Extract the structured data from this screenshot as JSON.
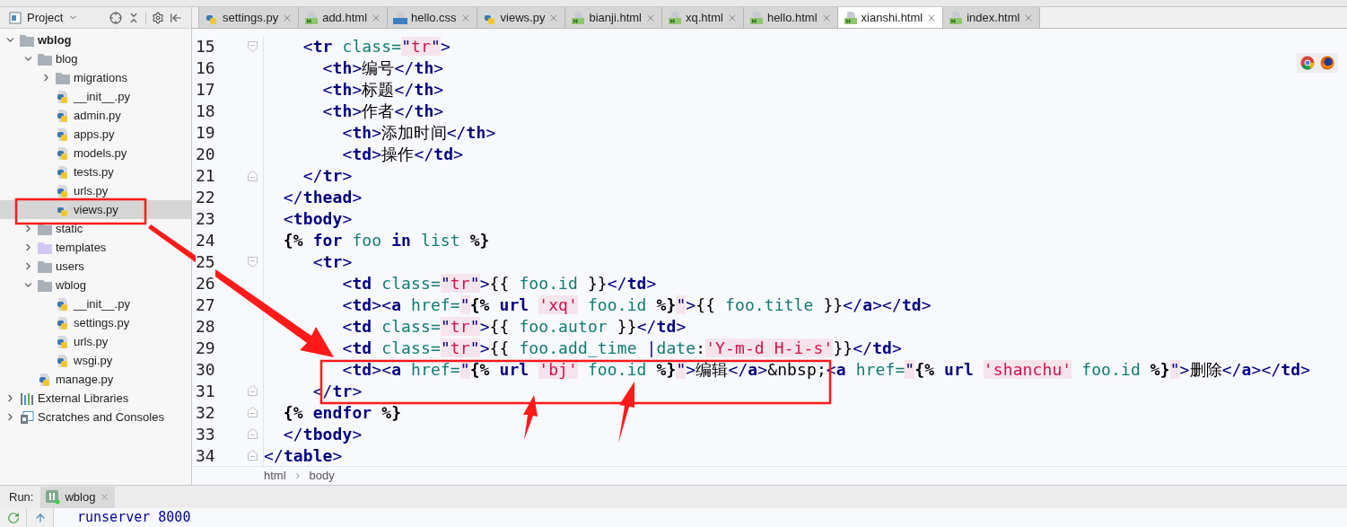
{
  "project_panel": {
    "title": "Project"
  },
  "tree": [
    {
      "label": "wblog",
      "kind": "project",
      "expanded": true,
      "selected": false,
      "children": [
        {
          "label": "blog",
          "kind": "folder",
          "expanded": true,
          "selected": false,
          "children": [
            {
              "label": "migrations",
              "kind": "folder",
              "expanded": false,
              "selected": false
            },
            {
              "label": "__init__.py",
              "kind": "py",
              "selected": false
            },
            {
              "label": "admin.py",
              "kind": "py",
              "selected": false
            },
            {
              "label": "apps.py",
              "kind": "py",
              "selected": false
            },
            {
              "label": "models.py",
              "kind": "py",
              "selected": false
            },
            {
              "label": "tests.py",
              "kind": "py",
              "selected": false
            },
            {
              "label": "urls.py",
              "kind": "py",
              "selected": false
            },
            {
              "label": "views.py",
              "kind": "py",
              "selected": true
            }
          ]
        },
        {
          "label": "static",
          "kind": "folder",
          "expanded": false,
          "selected": false
        },
        {
          "label": "templates",
          "kind": "templates",
          "expanded": false,
          "selected": false
        },
        {
          "label": "users",
          "kind": "folder",
          "expanded": false,
          "selected": false
        },
        {
          "label": "wblog",
          "kind": "folder",
          "expanded": true,
          "selected": false,
          "children": [
            {
              "label": "__init__.py",
              "kind": "py",
              "selected": false
            },
            {
              "label": "settings.py",
              "kind": "py",
              "selected": false
            },
            {
              "label": "urls.py",
              "kind": "py",
              "selected": false
            },
            {
              "label": "wsgi.py",
              "kind": "py",
              "selected": false
            }
          ]
        },
        {
          "label": "manage.py",
          "kind": "py",
          "selected": false
        }
      ]
    },
    {
      "label": "External Libraries",
      "kind": "libraries",
      "expanded": false,
      "selected": false
    },
    {
      "label": "Scratches and Consoles",
      "kind": "scratches",
      "expanded": false,
      "selected": false
    }
  ],
  "tabs": [
    {
      "label": "settings.py",
      "kind": "py",
      "selected": false
    },
    {
      "label": "add.html",
      "kind": "html",
      "selected": false
    },
    {
      "label": "hello.css",
      "kind": "css",
      "selected": false
    },
    {
      "label": "views.py",
      "kind": "py",
      "selected": false
    },
    {
      "label": "bianji.html",
      "kind": "html",
      "selected": false
    },
    {
      "label": "xq.html",
      "kind": "html",
      "selected": false
    },
    {
      "label": "hello.html",
      "kind": "html",
      "selected": false
    },
    {
      "label": "xianshi.html",
      "kind": "html",
      "selected": true
    },
    {
      "label": "index.html",
      "kind": "html",
      "selected": false
    }
  ],
  "editor": {
    "lines": [
      {
        "number": "15",
        "kind": "fold-start",
        "tokens": [
          {
            "kind": "p",
            "text": "    <"
          },
          {
            "kind": "tag",
            "text": "tr"
          },
          {
            "kind": "attr",
            "text": " class="
          },
          {
            "kind": "q",
            "text": "\""
          },
          {
            "kind": "str",
            "text": "tr"
          },
          {
            "kind": "q",
            "text": "\""
          },
          {
            "kind": "p",
            "text": ">"
          }
        ]
      },
      {
        "number": "16",
        "kind": "plain",
        "tokens": [
          {
            "kind": "p",
            "text": "      <"
          },
          {
            "kind": "tag",
            "text": "th"
          },
          {
            "kind": "p",
            "text": ">"
          },
          {
            "kind": "text",
            "text": "编号"
          },
          {
            "kind": "p",
            "text": "</"
          },
          {
            "kind": "tag",
            "text": "th"
          },
          {
            "kind": "p",
            "text": ">"
          }
        ]
      },
      {
        "number": "17",
        "kind": "plain",
        "tokens": [
          {
            "kind": "p",
            "text": "      <"
          },
          {
            "kind": "tag",
            "text": "th"
          },
          {
            "kind": "p",
            "text": ">"
          },
          {
            "kind": "text",
            "text": "标题"
          },
          {
            "kind": "p",
            "text": "</"
          },
          {
            "kind": "tag",
            "text": "th"
          },
          {
            "kind": "p",
            "text": ">"
          }
        ]
      },
      {
        "number": "18",
        "kind": "plain",
        "tokens": [
          {
            "kind": "p",
            "text": "      <"
          },
          {
            "kind": "tag",
            "text": "th"
          },
          {
            "kind": "p",
            "text": ">"
          },
          {
            "kind": "text",
            "text": "作者"
          },
          {
            "kind": "p",
            "text": "</"
          },
          {
            "kind": "tag",
            "text": "th"
          },
          {
            "kind": "p",
            "text": ">"
          }
        ]
      },
      {
        "number": "19",
        "kind": "plain",
        "tokens": [
          {
            "kind": "p",
            "text": "        <"
          },
          {
            "kind": "tag",
            "text": "th"
          },
          {
            "kind": "p",
            "text": ">"
          },
          {
            "kind": "text",
            "text": "添加时间"
          },
          {
            "kind": "p",
            "text": "</"
          },
          {
            "kind": "tag",
            "text": "th"
          },
          {
            "kind": "p",
            "text": ">"
          }
        ]
      },
      {
        "number": "20",
        "kind": "plain",
        "tokens": [
          {
            "kind": "p",
            "text": "        <"
          },
          {
            "kind": "tag",
            "text": "td"
          },
          {
            "kind": "p",
            "text": ">"
          },
          {
            "kind": "text",
            "text": "操作"
          },
          {
            "kind": "p",
            "text": "</"
          },
          {
            "kind": "tag",
            "text": "td"
          },
          {
            "kind": "p",
            "text": ">"
          }
        ]
      },
      {
        "number": "21",
        "kind": "fold-end",
        "tokens": [
          {
            "kind": "p",
            "text": "    </"
          },
          {
            "kind": "tag",
            "text": "tr"
          },
          {
            "kind": "p",
            "text": ">"
          }
        ]
      },
      {
        "number": "22",
        "kind": "plain",
        "tokens": [
          {
            "kind": "p",
            "text": "  </"
          },
          {
            "kind": "tag",
            "text": "thead"
          },
          {
            "kind": "p",
            "text": ">"
          }
        ]
      },
      {
        "number": "23",
        "kind": "plain",
        "tokens": [
          {
            "kind": "p",
            "text": "  <"
          },
          {
            "kind": "tag",
            "text": "tbody"
          },
          {
            "kind": "p",
            "text": ">"
          }
        ]
      },
      {
        "number": "24",
        "kind": "plain",
        "tokens": [
          {
            "kind": "tb",
            "text": "  {% "
          },
          {
            "kind": "kw",
            "text": "for"
          },
          {
            "kind": "var",
            "text": " foo "
          },
          {
            "kind": "kw",
            "text": "in"
          },
          {
            "kind": "var",
            "text": " list "
          },
          {
            "kind": "tb",
            "text": "%}"
          }
        ]
      },
      {
        "number": "25",
        "kind": "fold-start",
        "tokens": [
          {
            "kind": "p",
            "text": "     <"
          },
          {
            "kind": "tag",
            "text": "tr"
          },
          {
            "kind": "p",
            "text": ">"
          }
        ]
      },
      {
        "number": "26",
        "kind": "plain",
        "tokens": [
          {
            "kind": "p",
            "text": "        <"
          },
          {
            "kind": "tag",
            "text": "td"
          },
          {
            "kind": "attr",
            "text": " class="
          },
          {
            "kind": "q",
            "text": "\""
          },
          {
            "kind": "str",
            "text": "tr"
          },
          {
            "kind": "q",
            "text": "\""
          },
          {
            "kind": "p",
            "text": ">"
          },
          {
            "kind": "text",
            "text": "{{ "
          },
          {
            "kind": "var",
            "text": "foo.id"
          },
          {
            "kind": "text",
            "text": " }}"
          },
          {
            "kind": "p",
            "text": "</"
          },
          {
            "kind": "tag",
            "text": "td"
          },
          {
            "kind": "p",
            "text": ">"
          }
        ]
      },
      {
        "number": "27",
        "kind": "plain",
        "tokens": [
          {
            "kind": "p",
            "text": "        <"
          },
          {
            "kind": "tag",
            "text": "td"
          },
          {
            "kind": "p",
            "text": "><"
          },
          {
            "kind": "tag",
            "text": "a"
          },
          {
            "kind": "attr",
            "text": " href="
          },
          {
            "kind": "q",
            "text": "\""
          },
          {
            "kind": "tb",
            "text": "{% "
          },
          {
            "kind": "kw",
            "text": "url "
          },
          {
            "kind": "str",
            "text": "'xq'"
          },
          {
            "kind": "var",
            "text": " foo.id "
          },
          {
            "kind": "tb",
            "text": "%}"
          },
          {
            "kind": "q",
            "text": "\""
          },
          {
            "kind": "p",
            "text": ">"
          },
          {
            "kind": "text",
            "text": "{{ "
          },
          {
            "kind": "var",
            "text": "foo.title"
          },
          {
            "kind": "text",
            "text": " }}"
          },
          {
            "kind": "p",
            "text": "</"
          },
          {
            "kind": "tag",
            "text": "a"
          },
          {
            "kind": "p",
            "text": "></"
          },
          {
            "kind": "tag",
            "text": "td"
          },
          {
            "kind": "p",
            "text": ">"
          }
        ]
      },
      {
        "number": "28",
        "kind": "plain",
        "tokens": [
          {
            "kind": "p",
            "text": "        <"
          },
          {
            "kind": "tag",
            "text": "td"
          },
          {
            "kind": "attr",
            "text": " class="
          },
          {
            "kind": "q",
            "text": "\""
          },
          {
            "kind": "str",
            "text": "tr"
          },
          {
            "kind": "q",
            "text": "\""
          },
          {
            "kind": "p",
            "text": ">"
          },
          {
            "kind": "text",
            "text": "{{ "
          },
          {
            "kind": "var",
            "text": "foo.autor"
          },
          {
            "kind": "text",
            "text": " }}"
          },
          {
            "kind": "p",
            "text": "</"
          },
          {
            "kind": "tag",
            "text": "td"
          },
          {
            "kind": "p",
            "text": ">"
          }
        ]
      },
      {
        "number": "29",
        "kind": "plain",
        "tokens": [
          {
            "kind": "p",
            "text": "        <"
          },
          {
            "kind": "tag",
            "text": "td"
          },
          {
            "kind": "attr",
            "text": " class="
          },
          {
            "kind": "q",
            "text": "\""
          },
          {
            "kind": "str",
            "text": "tr"
          },
          {
            "kind": "q",
            "text": "\""
          },
          {
            "kind": "p",
            "text": ">"
          },
          {
            "kind": "text",
            "text": "{{ "
          },
          {
            "kind": "var",
            "text": "foo.add_time "
          },
          {
            "kind": "p",
            "text": "|"
          },
          {
            "kind": "var",
            "text": "date"
          },
          {
            "kind": "text",
            "text": ":"
          },
          {
            "kind": "str",
            "text": "'Y-m-d H-i-s'"
          },
          {
            "kind": "text",
            "text": "}}"
          },
          {
            "kind": "p",
            "text": "</"
          },
          {
            "kind": "tag",
            "text": "td"
          },
          {
            "kind": "p",
            "text": ">"
          }
        ]
      },
      {
        "number": "30",
        "kind": "plain",
        "tokens": [
          {
            "kind": "p",
            "text": "        <"
          },
          {
            "kind": "tag",
            "text": "td"
          },
          {
            "kind": "p",
            "text": "><"
          },
          {
            "kind": "tag",
            "text": "a"
          },
          {
            "kind": "attr",
            "text": " href="
          },
          {
            "kind": "q",
            "text": "\""
          },
          {
            "kind": "tb",
            "text": "{% "
          },
          {
            "kind": "kw",
            "text": "url "
          },
          {
            "kind": "str",
            "text": "'bj'"
          },
          {
            "kind": "var",
            "text": " foo.id "
          },
          {
            "kind": "tb",
            "text": "%}"
          },
          {
            "kind": "q",
            "text": "\""
          },
          {
            "kind": "p",
            "text": ">"
          },
          {
            "kind": "text",
            "text": "编辑"
          },
          {
            "kind": "p",
            "text": "</"
          },
          {
            "kind": "tag",
            "text": "a"
          },
          {
            "kind": "p",
            "text": ">"
          },
          {
            "kind": "text",
            "text": "&nbsp;"
          },
          {
            "kind": "p",
            "text": "<"
          },
          {
            "kind": "tag",
            "text": "a"
          },
          {
            "kind": "attr",
            "text": " href="
          },
          {
            "kind": "q",
            "text": "\""
          },
          {
            "kind": "tb",
            "text": "{% "
          },
          {
            "kind": "kw",
            "text": "url "
          },
          {
            "kind": "str",
            "text": "'shanchu'"
          },
          {
            "kind": "var",
            "text": " foo.id "
          },
          {
            "kind": "tb",
            "text": "%}"
          },
          {
            "kind": "q",
            "text": "\""
          },
          {
            "kind": "p",
            "text": ">"
          },
          {
            "kind": "text",
            "text": "删除"
          },
          {
            "kind": "p",
            "text": "</"
          },
          {
            "kind": "tag",
            "text": "a"
          },
          {
            "kind": "p",
            "text": "></"
          },
          {
            "kind": "tag",
            "text": "td"
          },
          {
            "kind": "p",
            "text": ">"
          }
        ]
      },
      {
        "number": "31",
        "kind": "fold-end",
        "tokens": [
          {
            "kind": "p",
            "text": "     </"
          },
          {
            "kind": "tag",
            "text": "tr"
          },
          {
            "kind": "p",
            "text": ">"
          }
        ]
      },
      {
        "number": "32",
        "kind": "fold-end",
        "tokens": [
          {
            "kind": "tb",
            "text": "  {% "
          },
          {
            "kind": "kw",
            "text": "endfor"
          },
          {
            "kind": "tb",
            "text": " %}"
          }
        ]
      },
      {
        "number": "33",
        "kind": "fold-end",
        "tokens": [
          {
            "kind": "p",
            "text": "  </"
          },
          {
            "kind": "tag",
            "text": "tbody"
          },
          {
            "kind": "p",
            "text": ">"
          }
        ]
      },
      {
        "number": "34",
        "kind": "fold-end",
        "tokens": [
          {
            "kind": "p",
            "text": "</"
          },
          {
            "kind": "tag",
            "text": "table"
          },
          {
            "kind": "p",
            "text": ">"
          }
        ]
      }
    ]
  },
  "breadcrumbs": [
    "html",
    "body"
  ],
  "run_panel": {
    "label": "Run:",
    "tab": "wblog",
    "console": [
      "runserver 8000"
    ]
  }
}
